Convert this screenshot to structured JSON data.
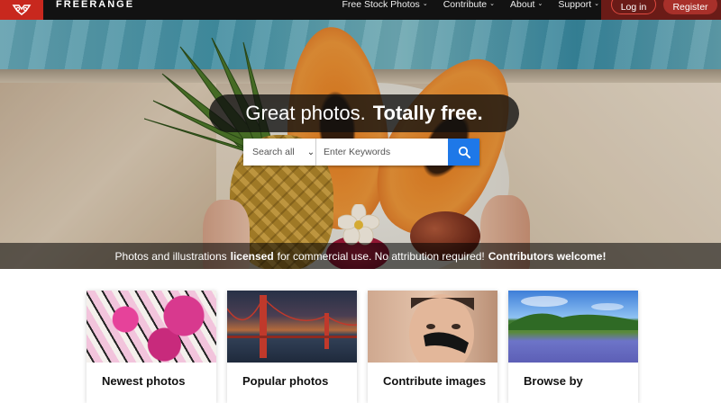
{
  "brand": {
    "logo_text": "FREERANGE"
  },
  "nav": {
    "items": [
      {
        "label": "Free Stock Photos"
      },
      {
        "label": "Contribute"
      },
      {
        "label": "About"
      },
      {
        "label": "Support"
      }
    ]
  },
  "auth": {
    "login_label": "Log in",
    "register_label": "Register"
  },
  "hero": {
    "tagline_regular": "Great photos.",
    "tagline_bold": "Totally free.",
    "search": {
      "scope_selected": "Search all",
      "input_placeholder": "Enter Keywords"
    },
    "caption": {
      "part1": "Photos and illustrations",
      "part2_bold": "licensed",
      "part3": "for commercial use. No attribution required!",
      "part4_bold": "Contributors welcome!"
    }
  },
  "cards": [
    {
      "title": "Newest photos"
    },
    {
      "title": "Popular photos"
    },
    {
      "title": "Contribute images"
    },
    {
      "title": "Browse by"
    }
  ],
  "colors": {
    "topbar": "#121212",
    "logo_red": "#c8281e",
    "auth_bg": "#6a1b17",
    "search_button": "#1e78e8"
  }
}
